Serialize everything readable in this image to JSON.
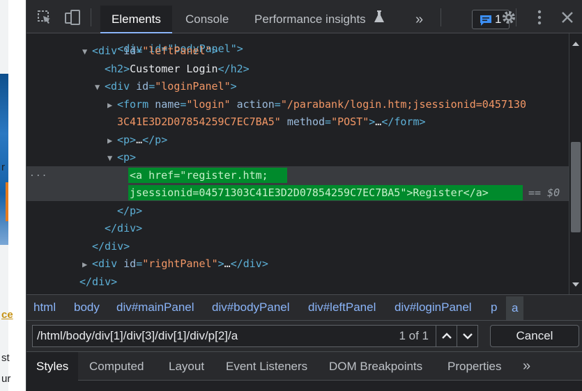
{
  "page_sliver": {
    "letters": [
      "r",
      "ce",
      "st",
      "ur"
    ]
  },
  "toolbar": {
    "tabs": [
      "Elements",
      "Console",
      "Performance insights"
    ],
    "more_tabs_glyph": "»",
    "issues_count": "1"
  },
  "dom": {
    "lines": {
      "body_panel_tag": "<div id=\"bodyPanel\">",
      "left_panel_open": "div",
      "left_panel_id": "leftPanel",
      "h2_text": "Customer Login",
      "login_panel_id": "loginPanel",
      "form_name": "login",
      "form_action_1": "/parabank/login.htm;jsessionid=0457130",
      "form_action_2": "3C41E3D2D07854259C7EC7BA5",
      "form_method": "POST",
      "ellipsis": "…",
      "href_1": "register.htm;",
      "href_2": "jsessionid=04571303C41E3D2D07854259C7EC7BA5",
      "link_text": "Register",
      "dollar0": "== $0",
      "right_panel_id": "rightPanel",
      "gutter_dots": "..."
    }
  },
  "breadcrumbs": [
    "html",
    "body",
    "div#mainPanel",
    "div#bodyPanel",
    "div#leftPanel",
    "div#loginPanel",
    "p",
    "a"
  ],
  "search": {
    "query": "/html/body/div[1]/div[3]/div[1]/div/p[2]/a",
    "match_count": "1 of 1",
    "cancel_label": "Cancel"
  },
  "subtabs": [
    "Styles",
    "Computed",
    "Layout",
    "Event Listeners",
    "DOM Breakpoints",
    "Properties"
  ],
  "subtabs_more_glyph": "»"
}
